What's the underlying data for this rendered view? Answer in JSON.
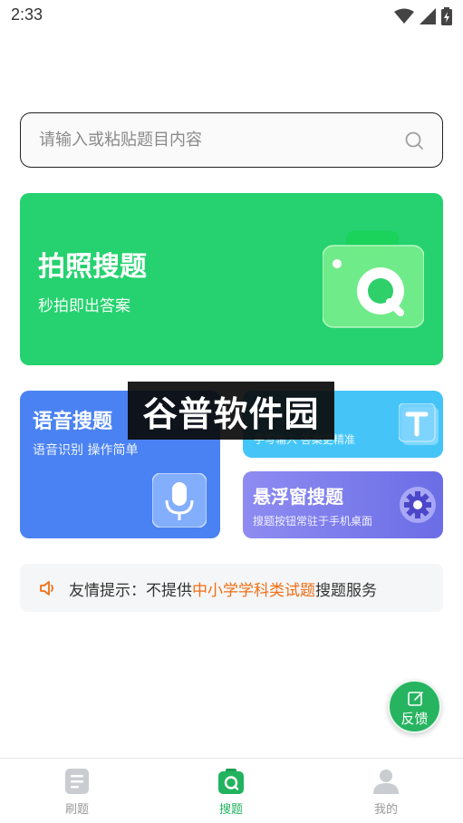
{
  "status_bar": {
    "time": "2:33"
  },
  "search": {
    "placeholder": "请输入或粘贴题目内容"
  },
  "photo_card": {
    "title": "拍照搜题",
    "subtitle": "秒拍即出答案"
  },
  "voice_card": {
    "title": "语音搜题",
    "subtitle": "语音识别 操作简单"
  },
  "text_card": {
    "subtitle": "手写输入 答案更精准"
  },
  "float_card": {
    "title": "悬浮窗搜题",
    "subtitle": "搜题按钮常驻于手机桌面"
  },
  "watermark": {
    "text": "谷普软件园"
  },
  "tip": {
    "prefix": "友情提示：不提供",
    "highlight": "中小学学科类试题",
    "suffix": "搜题服务"
  },
  "feedback": {
    "label": "反馈"
  },
  "tabs": [
    {
      "label": "刷题",
      "icon": "document-icon",
      "active": false
    },
    {
      "label": "搜题",
      "icon": "search-camera-icon",
      "active": true
    },
    {
      "label": "我的",
      "icon": "profile-icon",
      "active": false
    }
  ],
  "colors": {
    "accent": "#22b35e",
    "photo_card": "#25d26f",
    "voice_card": "#4a82f3",
    "text_card": "#45c5f7",
    "float_card": "#7b7aec",
    "tip_highlight": "#f06e14"
  }
}
